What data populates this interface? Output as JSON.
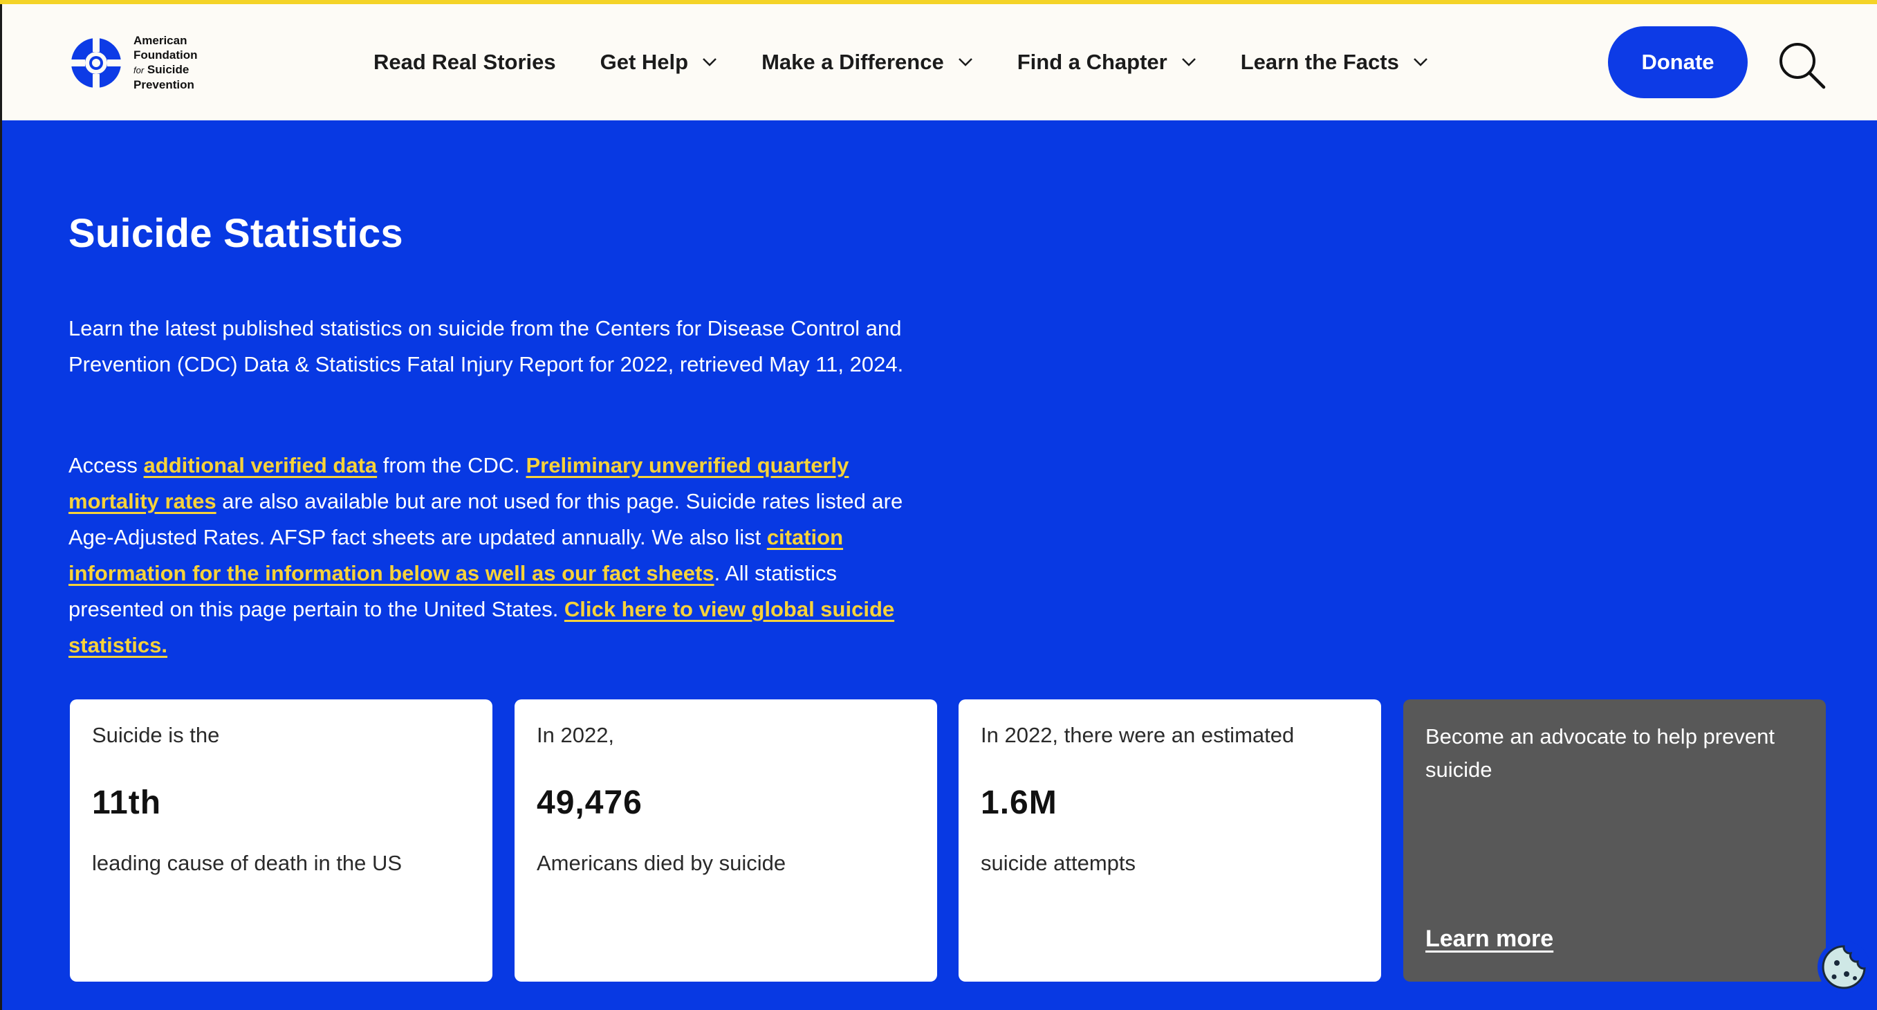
{
  "colors": {
    "accent_yellow": "#f4d327",
    "brand_blue": "#0839e3",
    "donate_blue": "#0d3be6",
    "link_yellow": "#f7d23a",
    "advocate_gray": "#585858"
  },
  "header": {
    "logo": {
      "line1": "American",
      "line2": "Foundation",
      "line3_small": "for",
      "line3": "Suicide",
      "line4": "Prevention"
    },
    "nav": [
      {
        "label": "Read Real Stories",
        "has_dropdown": false
      },
      {
        "label": "Get Help",
        "has_dropdown": true
      },
      {
        "label": "Make a Difference",
        "has_dropdown": true
      },
      {
        "label": "Find a Chapter",
        "has_dropdown": true
      },
      {
        "label": "Learn the Facts",
        "has_dropdown": true
      }
    ],
    "donate_label": "Donate",
    "search_icon": "search-icon"
  },
  "hero": {
    "title": "Suicide Statistics",
    "intro": "Learn the latest published statistics on suicide from the Centers for Disease Control and Prevention (CDC) Data & Statistics Fatal Injury Report for 2022, retrieved May 11, 2024.",
    "access": {
      "t1": "Access ",
      "link1": "additional verified data",
      "t2": " from the CDC. ",
      "link2": "Preliminary unverified quarterly mortality rates",
      "t3": " are also available but are not used for this page. Suicide rates listed are Age-Adjusted Rates. AFSP fact sheets are updated annually. We also list ",
      "link3": "citation information for the information below as well as our fact sheets",
      "t4": ". All statistics presented on this page pertain to the United States. ",
      "link4": "Click here to view global suicide statistics."
    }
  },
  "cards": [
    {
      "lead": "Suicide is the",
      "big": "11th",
      "sub": "leading cause of death in the US"
    },
    {
      "lead": "In 2022,",
      "big": "49,476",
      "sub": "Americans died by suicide"
    },
    {
      "lead": "In 2022, there were an estimated",
      "big": "1.6M",
      "sub": "suicide attempts"
    }
  ],
  "advocate": {
    "lead": "Become an advocate to help prevent suicide",
    "link": "Learn more"
  },
  "cookie_icon": "cookie-icon"
}
